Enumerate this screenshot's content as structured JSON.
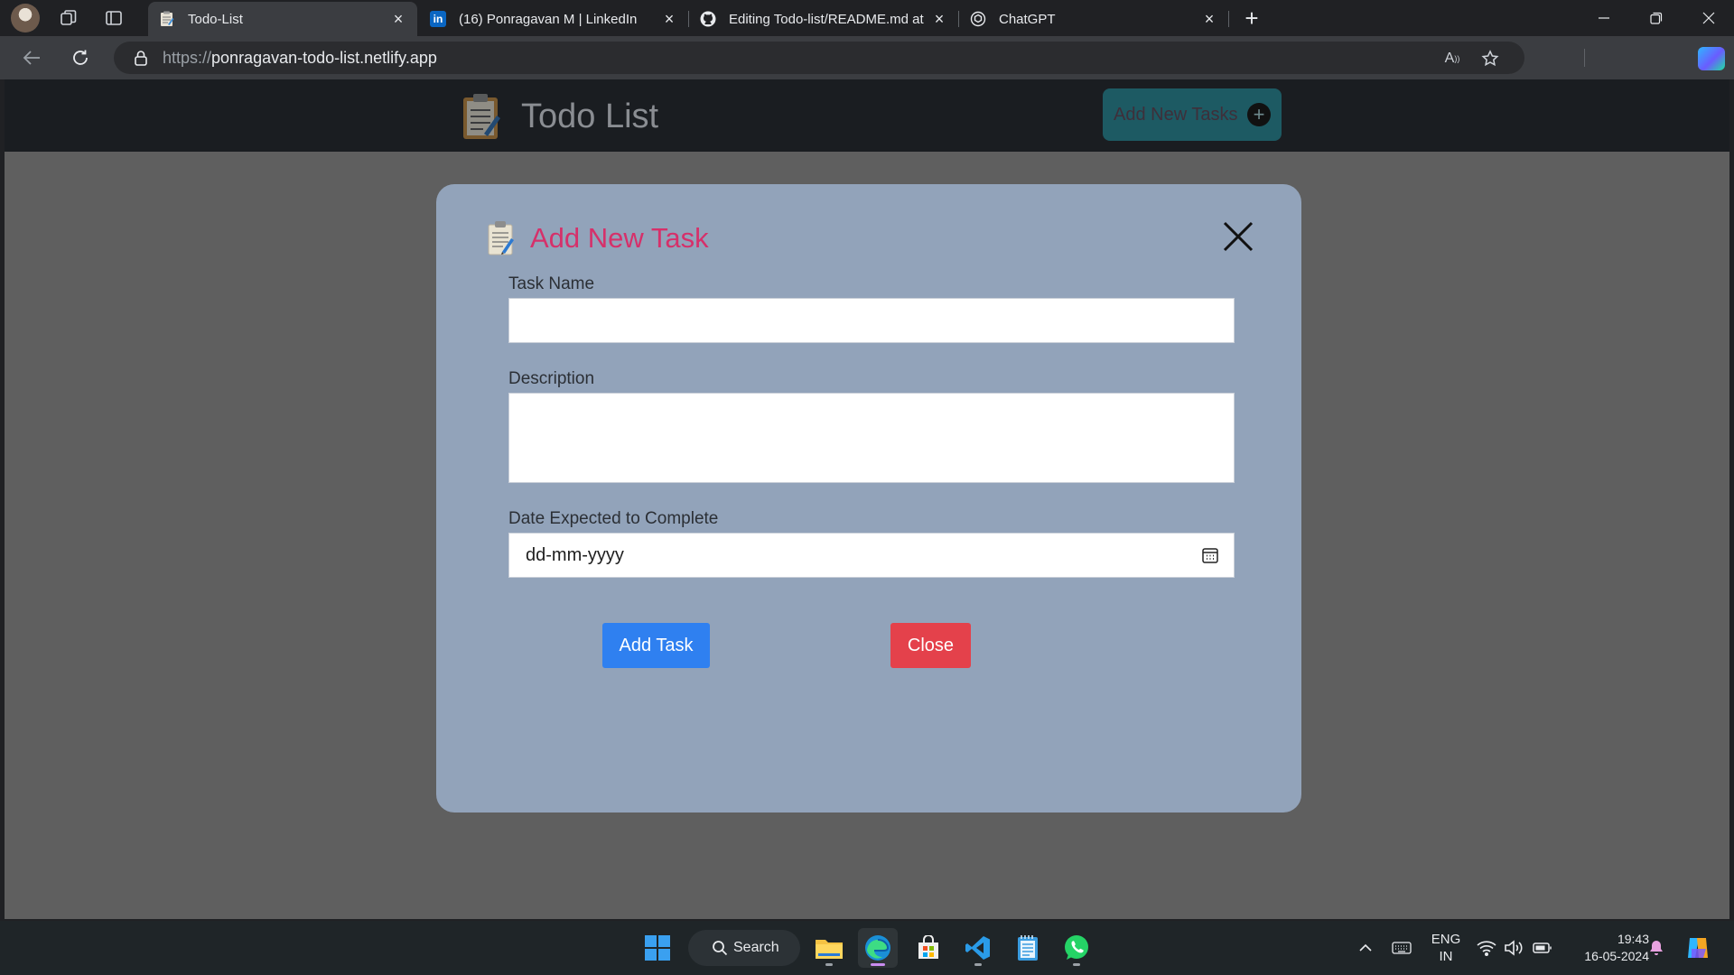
{
  "browser": {
    "tabs": [
      {
        "title": "Todo-List",
        "favicon": "notepad-favicon",
        "active": true
      },
      {
        "title": "(16) Ponragavan M | LinkedIn",
        "favicon": "linkedin-favicon",
        "active": false
      },
      {
        "title": "Editing Todo-list/README.md at",
        "favicon": "github-favicon",
        "active": false
      },
      {
        "title": "ChatGPT",
        "favicon": "chatgpt-favicon",
        "active": false
      }
    ],
    "url_scheme": "https://",
    "url_host": "ponragavan-todo-list.netlify.app"
  },
  "app": {
    "title": "Todo List",
    "add_button_label": "Add New Tasks",
    "add_button_icon": "+"
  },
  "modal": {
    "title": "Add New Task",
    "task_name_label": "Task Name",
    "task_name_value": "",
    "description_label": "Description",
    "description_value": "",
    "date_label": "Date Expected to Complete",
    "date_placeholder": "dd-mm-yyyy",
    "add_button": "Add Task",
    "close_button": "Close"
  },
  "taskbar": {
    "search_label": "Search",
    "language_line1": "ENG",
    "language_line2": "IN",
    "time": "19:43",
    "date": "16-05-2024"
  },
  "colors": {
    "modal_bg": "#92a3ba",
    "title_accent": "#d6306a",
    "add_task_button": "#2f80f0",
    "close_button": "#e4414b",
    "page_overlay": "#5f5f5f"
  }
}
